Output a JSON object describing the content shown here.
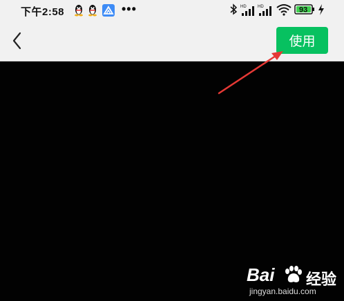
{
  "status_bar": {
    "time": "下午2:58",
    "more": "•••",
    "battery_level": "93",
    "signal_label_1": "HD",
    "signal_label_2": "HD",
    "icons": [
      "qq-penguin-icon",
      "qq-penguin-icon",
      "app-triangle-icon",
      "bluetooth-icon",
      "signal-icon",
      "signal-icon",
      "wifi-icon",
      "battery-icon",
      "charging-icon"
    ]
  },
  "app_bar": {
    "back_icon": "chevron-left-icon",
    "use_label": "使用",
    "accent": "#07c160"
  },
  "watermark": {
    "brand": "Bai",
    "brand_suffix": "经验",
    "url": "jingyan.baidu.com"
  },
  "colors": {
    "annotation_arrow": "#e53935",
    "status_bar_bg": "#f1f1f1",
    "content_bg": "#020202"
  }
}
